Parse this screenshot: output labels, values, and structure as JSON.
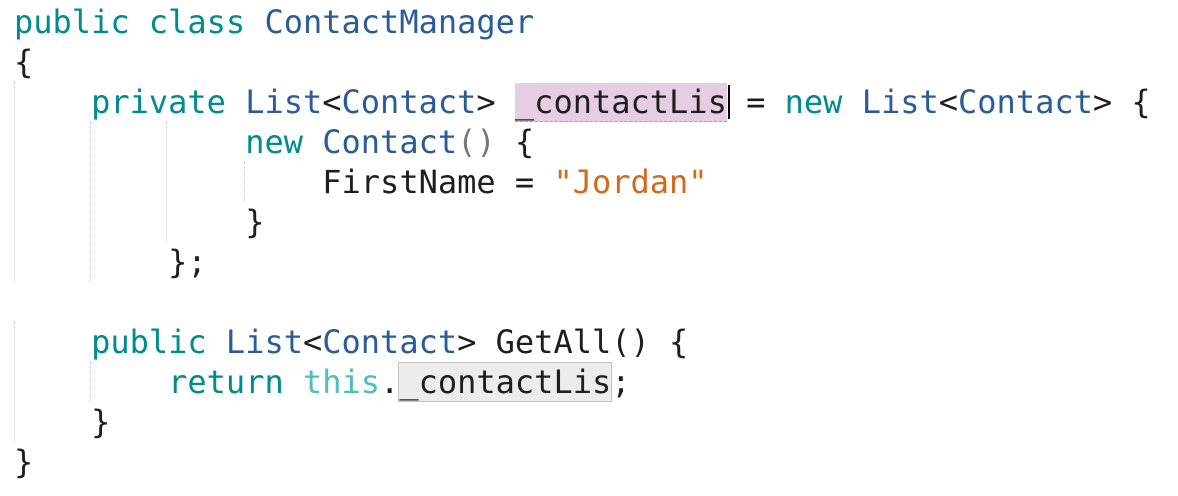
{
  "code": {
    "line1": {
      "kw_public": "public",
      "kw_class": "class",
      "class_name": "ContactManager"
    },
    "line2": {
      "brace": "{"
    },
    "line3": {
      "kw_private": "private",
      "type_list": "List",
      "lt": "<",
      "type_contact": "Contact",
      "gt": ">",
      "field_name": "_contactLis",
      "assign": "=",
      "kw_new": "new",
      "type_list2": "List",
      "lt2": "<",
      "type_contact2": "Contact",
      "gt2": ">",
      "brace": "{"
    },
    "line4": {
      "kw_new": "new",
      "type_contact": "Contact",
      "parens": "()",
      "brace": "{"
    },
    "line5": {
      "prop": "FirstName",
      "assign": "=",
      "value": "\"Jordan\""
    },
    "line6": {
      "brace": "}"
    },
    "line7": {
      "close": "};"
    },
    "line9": {
      "kw_public": "public",
      "type_list": "List",
      "lt": "<",
      "type_contact": "Contact",
      "gt": ">",
      "method": "GetAll() {"
    },
    "line10": {
      "kw_return": "return",
      "kw_this": "this",
      "dot": ".",
      "field_ref": "_contactLis",
      "semi": ";"
    },
    "line11": {
      "brace": "}"
    },
    "line12": {
      "brace": "}"
    }
  },
  "colors": {
    "keyword": "#008c8c",
    "type": "#2b5c97",
    "string": "#d26a1c",
    "this": "#4fbdbd",
    "rename_highlight": "#e6cde3",
    "reference_highlight": "#ececea"
  }
}
